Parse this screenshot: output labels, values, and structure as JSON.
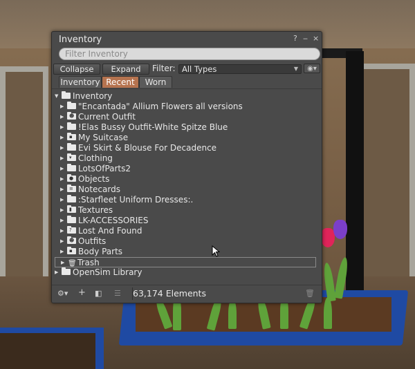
{
  "window": {
    "title": "Inventory",
    "help_label": "?",
    "minimize_label": "‒",
    "close_label": "×",
    "search": {
      "placeholder": "Filter Inventory",
      "value": ""
    },
    "toolbar": {
      "collapse_label": "Collapse",
      "expand_label": "Expand",
      "filter_label": "Filter:",
      "filter_value": "All Types"
    },
    "tabs": [
      {
        "label": "Inventory",
        "active": false
      },
      {
        "label": "Recent",
        "active": true
      },
      {
        "label": "Worn",
        "active": false
      }
    ],
    "tree": {
      "root": "Inventory",
      "items": [
        {
          "label": "\"Encantada\" Allium Flowers all versions",
          "icon": "folder-icon"
        },
        {
          "label": "Current Outfit",
          "icon": "current-outfit-folder-icon"
        },
        {
          "label": "!Elas Bussy Outfit-White Spitze Blue",
          "icon": "folder-icon"
        },
        {
          "label": "My Suitcase",
          "icon": "suitcase-folder-icon"
        },
        {
          "label": "Evi Skirt & Blouse For Decadence",
          "icon": "folder-icon"
        },
        {
          "label": "Clothing",
          "icon": "clothing-folder-icon"
        },
        {
          "label": "LotsOfParts2",
          "icon": "folder-icon"
        },
        {
          "label": "Objects",
          "icon": "objects-folder-icon"
        },
        {
          "label": "Notecards",
          "icon": "notecards-folder-icon"
        },
        {
          "label": ":Starfleet Uniform  Dresses:.",
          "icon": "folder-icon"
        },
        {
          "label": "Textures",
          "icon": "textures-folder-icon"
        },
        {
          "label": "LK-ACCESSORIES",
          "icon": "folder-icon"
        },
        {
          "label": "Lost And Found",
          "icon": "lost-found-folder-icon"
        },
        {
          "label": "Outfits",
          "icon": "outfits-folder-icon"
        },
        {
          "label": "Body Parts",
          "icon": "body-parts-folder-icon"
        },
        {
          "label": "Trash",
          "icon": "trash-icon"
        }
      ],
      "library": "OpenSim Library"
    },
    "status": {
      "count": "63,174 Elements"
    }
  }
}
